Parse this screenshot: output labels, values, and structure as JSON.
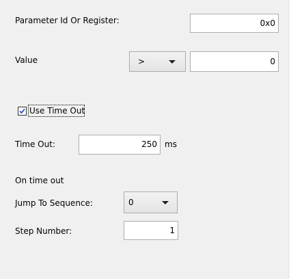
{
  "param": {
    "label": "Parameter Id Or Register:",
    "value": "0x0"
  },
  "value_row": {
    "label": "Value",
    "operator": ">",
    "value": "0"
  },
  "timeout": {
    "checkbox_label": "Use Time Out",
    "checked": true,
    "label": "Time Out:",
    "value": "250",
    "unit": "ms"
  },
  "on_timeout": {
    "heading": "On time out",
    "jump_label": "Jump To Sequence:",
    "jump_value": "0",
    "step_label": "Step Number:",
    "step_value": "1"
  }
}
